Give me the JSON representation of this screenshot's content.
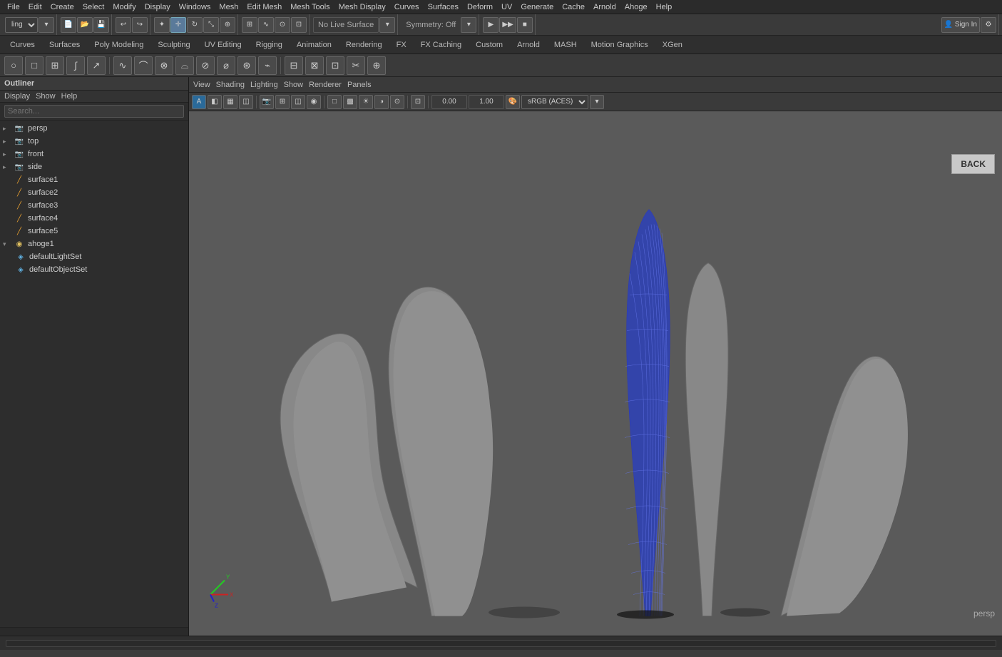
{
  "menubar": {
    "items": [
      "File",
      "Edit",
      "Create",
      "Select",
      "Modify",
      "Display",
      "Windows",
      "Mesh",
      "Edit Mesh",
      "Mesh Tools",
      "Mesh Display",
      "Curves",
      "Surfaces",
      "Deform",
      "UV",
      "Generate",
      "Cache",
      "Arnold",
      "Ahoge",
      "Help"
    ]
  },
  "toolbar1": {
    "mode_dropdown": "ling",
    "live_surface": "No Live Surface",
    "symmetry": "Symmetry: Off"
  },
  "tabbar": {
    "tabs": [
      "Curves",
      "Surfaces",
      "Poly Modeling",
      "Sculpting",
      "UV Editing",
      "Rigging",
      "Animation",
      "Rendering",
      "FX",
      "FX Caching",
      "Custom",
      "Arnold",
      "MASH",
      "Motion Graphics",
      "XGen"
    ]
  },
  "outliner": {
    "title": "Outliner",
    "subbar": [
      "Display",
      "Show",
      "Help"
    ],
    "search_placeholder": "Search...",
    "items": [
      {
        "id": "persp",
        "label": "persp",
        "type": "cam",
        "indent": 0,
        "expanded": true
      },
      {
        "id": "top",
        "label": "top",
        "type": "cam",
        "indent": 0,
        "expanded": true
      },
      {
        "id": "front",
        "label": "front",
        "type": "cam",
        "indent": 0,
        "expanded": true
      },
      {
        "id": "side",
        "label": "side",
        "type": "cam",
        "indent": 0,
        "expanded": true
      },
      {
        "id": "surface1",
        "label": "surface1",
        "type": "curve",
        "indent": 0
      },
      {
        "id": "surface2",
        "label": "surface2",
        "type": "curve",
        "indent": 0
      },
      {
        "id": "surface3",
        "label": "surface3",
        "type": "curve",
        "indent": 0
      },
      {
        "id": "surface4",
        "label": "surface4",
        "type": "curve",
        "indent": 0
      },
      {
        "id": "surface5",
        "label": "surface5",
        "type": "curve",
        "indent": 0
      },
      {
        "id": "ahoge1",
        "label": "ahoge1",
        "type": "sphere",
        "indent": 0,
        "expanded": true
      },
      {
        "id": "defaultLightSet",
        "label": "defaultLightSet",
        "type": "set",
        "indent": 1
      },
      {
        "id": "defaultObjectSet",
        "label": "defaultObjectSet",
        "type": "set",
        "indent": 1
      }
    ]
  },
  "viewport": {
    "menus": [
      "View",
      "Shading",
      "Lighting",
      "Show",
      "Renderer",
      "Panels"
    ],
    "value1": "0.00",
    "value2": "1.00",
    "colorspace": "sRGB (ACES)",
    "label": "persp"
  },
  "back_btn": "BACK",
  "statusbar": {}
}
